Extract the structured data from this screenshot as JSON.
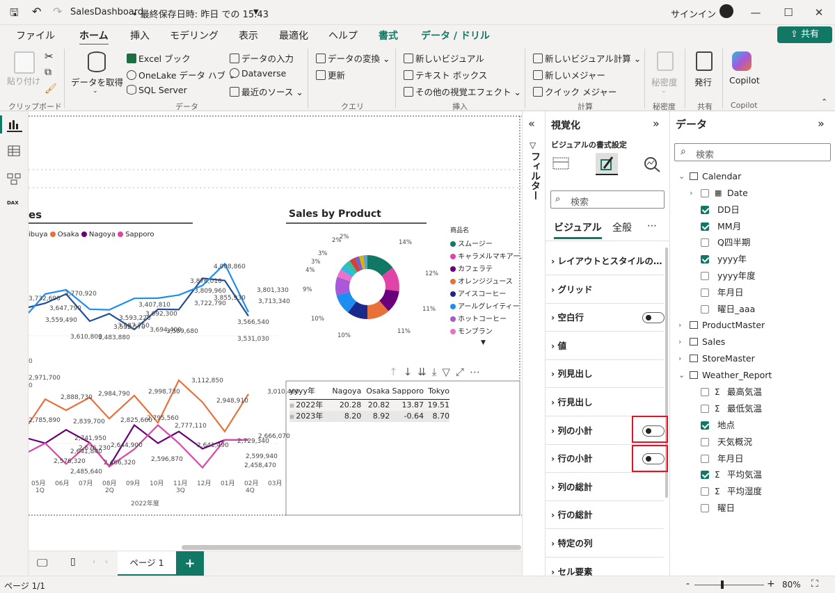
{
  "titlebar": {
    "filename": "SalesDashboard",
    "saved": "• 最終保存日時: 昨日 での 15:43",
    "signin": "サインイン"
  },
  "menu": {
    "file": "ファイル",
    "home": "ホーム",
    "insert": "挿入",
    "modeling": "モデリング",
    "view": "表示",
    "optimize": "最適化",
    "help": "ヘルプ",
    "format": "書式",
    "data_drill": "データ / ドリル",
    "share": "共有"
  },
  "ribbon": {
    "paste": "貼り付け",
    "clipboard": "クリップボード",
    "get_data": "データを取得",
    "excel": "Excel ブック",
    "onelake": "OneLake データ ハブ",
    "sql": "SQL Server",
    "enter_data": "データの入力",
    "dataverse": "Dataverse",
    "recent": "最近のソース",
    "data_group": "データ",
    "transform": "データの変換",
    "refresh": "更新",
    "query_group": "クエリ",
    "new_visual": "新しいビジュアル",
    "textbox": "テキスト ボックス",
    "more_visuals": "その他の視覚エフェクト",
    "insert_group": "挿入",
    "new_visual_calc": "新しいビジュアル計算",
    "new_measure": "新しいメジャー",
    "quick_measure": "クイック メジャー",
    "calc_group": "計算",
    "sensitivity": "秘密度",
    "sensitivity_group": "秘密度",
    "publish": "発行",
    "share_group": "共有",
    "copilot": "Copilot",
    "copilot_group": "Copilot"
  },
  "line_chart": {
    "title_partial": "es",
    "legend": [
      {
        "name": "ibuya",
        "color": "#1f4e9a"
      },
      {
        "name": "Osaka",
        "color": "#e8703a"
      },
      {
        "name": "Nagoya",
        "color": "#6b007b"
      },
      {
        "name": "Sapporo",
        "color": "#e044a7"
      }
    ],
    "top_labels": [
      "3,732,690",
      "3,647,790",
      "3,770,920",
      "3,559,490",
      "3,610,800",
      "3,483,880",
      "3,593,220",
      "3,552,570",
      "3,587,750",
      "3,407,810",
      "3,692,300",
      "3,694,400",
      "3,589,680",
      "3,876,010",
      "3,809,960",
      "3,722,790",
      "4,008,860",
      "3,855,930",
      "3,801,330",
      "3,713,340",
      "3,566,540",
      "3,531,030"
    ],
    "bottom_labels": [
      "2,971,700",
      "2,888,730",
      "2,785,890",
      "2,984,790",
      "2,839,700",
      "2,998,730",
      "2,825,660",
      "2,795,560",
      "3,112,850",
      "2,948,910",
      "3,010,460",
      "2,741,950",
      "2,676,230",
      "2,641,840",
      "2,576,320",
      "2,485,640",
      "2,644,900",
      "2,466,320",
      "2,596,870",
      "2,777,110",
      "2,641,490",
      "2,729,340",
      "2,599,940",
      "2,458,470",
      "2,666,070"
    ],
    "x_months": [
      "05月",
      "06月",
      "07月",
      "08月",
      "09月",
      "10月",
      "11月",
      "12月",
      "01月",
      "02月",
      "03月"
    ],
    "quarters": [
      "1Q",
      "2Q",
      "3Q",
      "4Q"
    ],
    "year_label": "2022年度",
    "axis_vals": [
      "0",
      "0"
    ]
  },
  "donut": {
    "title": "Sales by Product",
    "legend_title": "商品名",
    "items": [
      {
        "name": "スムージー",
        "pct": 14,
        "color": "#117865"
      },
      {
        "name": "キャラメルマキアー…",
        "pct": 12,
        "color": "#e044a7"
      },
      {
        "name": "カフェラテ",
        "pct": 11,
        "color": "#6b007b"
      },
      {
        "name": "オレンジジュース",
        "pct": 11,
        "color": "#e8703a"
      },
      {
        "name": "アイスコーヒー",
        "pct": 10,
        "color": "#1a2a8c"
      },
      {
        "name": "アールグレイティー",
        "pct": 10,
        "color": "#1d8ef0"
      },
      {
        "name": "ホットコーヒー",
        "pct": 9,
        "color": "#a858d8"
      },
      {
        "name": "モンブラン",
        "pct": 4,
        "color": "#e873c8"
      },
      {
        "name": "",
        "pct": 3,
        "color": "#2fb8e0"
      },
      {
        "name": "",
        "pct": 3,
        "color": "#36c0a0"
      },
      {
        "name": "",
        "pct": 3,
        "color": "#d04040"
      },
      {
        "name": "",
        "pct": 2,
        "color": "#7060d0"
      },
      {
        "name": "",
        "pct": 2,
        "color": "#e0b000"
      },
      {
        "name": "",
        "pct": 2,
        "color": "#60a0d0"
      }
    ],
    "labels": [
      "14%",
      "12%",
      "11%",
      "11%",
      "10%",
      "10%",
      "9%",
      "4%",
      "3%",
      "3%",
      "2%",
      "2%"
    ]
  },
  "matrix": {
    "headers": [
      "yyyy年",
      "Nagoya",
      "Osaka",
      "Sapporo",
      "Tokyo"
    ],
    "rows": [
      [
        "2022年",
        "20.28",
        "20.82",
        "13.87",
        "19.51"
      ],
      [
        "2023年",
        "8.20",
        "8.92",
        "-0.64",
        "8.70"
      ]
    ]
  },
  "filter_pane": {
    "label": "フィルター"
  },
  "viz_pane": {
    "title": "視覚化",
    "subtitle": "ビジュアルの書式設定",
    "search": "検索",
    "tab_visual": "ビジュアル",
    "tab_general": "全般",
    "sections": [
      "レイアウトとスタイルの…",
      "グリッド",
      "空白行",
      "値",
      "列見出し",
      "行見出し",
      "列の小計",
      "行の小計",
      "列の総計",
      "行の総計",
      "特定の列",
      "セル要素"
    ]
  },
  "data_pane": {
    "title": "データ",
    "search": "検索",
    "tables": [
      {
        "name": "Calendar",
        "expanded": true,
        "fields": [
          {
            "name": "Date",
            "checked": false,
            "kind": "date"
          },
          {
            "name": "DD日",
            "checked": true
          },
          {
            "name": "MM月",
            "checked": true
          },
          {
            "name": "Q四半期",
            "checked": false
          },
          {
            "name": "yyyy年",
            "checked": true
          },
          {
            "name": "yyyy年度",
            "checked": false
          },
          {
            "name": "年月日",
            "checked": false
          },
          {
            "name": "曜日_aaa",
            "checked": false
          }
        ]
      },
      {
        "name": "ProductMaster",
        "expanded": false
      },
      {
        "name": "Sales",
        "expanded": false
      },
      {
        "name": "StoreMaster",
        "expanded": false
      },
      {
        "name": "Weather_Report",
        "expanded": true,
        "fields": [
          {
            "name": "最高気温",
            "checked": false,
            "sigma": true
          },
          {
            "name": "最低気温",
            "checked": false,
            "sigma": true
          },
          {
            "name": "地点",
            "checked": true
          },
          {
            "name": "天気概況",
            "checked": false
          },
          {
            "name": "年月日",
            "checked": false
          },
          {
            "name": "平均気温",
            "checked": true,
            "sigma": true
          },
          {
            "name": "平均湿度",
            "checked": false,
            "sigma": true
          },
          {
            "name": "曜日",
            "checked": false
          }
        ]
      }
    ]
  },
  "pages": {
    "tab": "ページ 1",
    "add": "+"
  },
  "status": {
    "page": "ページ 1/1",
    "zoom": "80%"
  }
}
